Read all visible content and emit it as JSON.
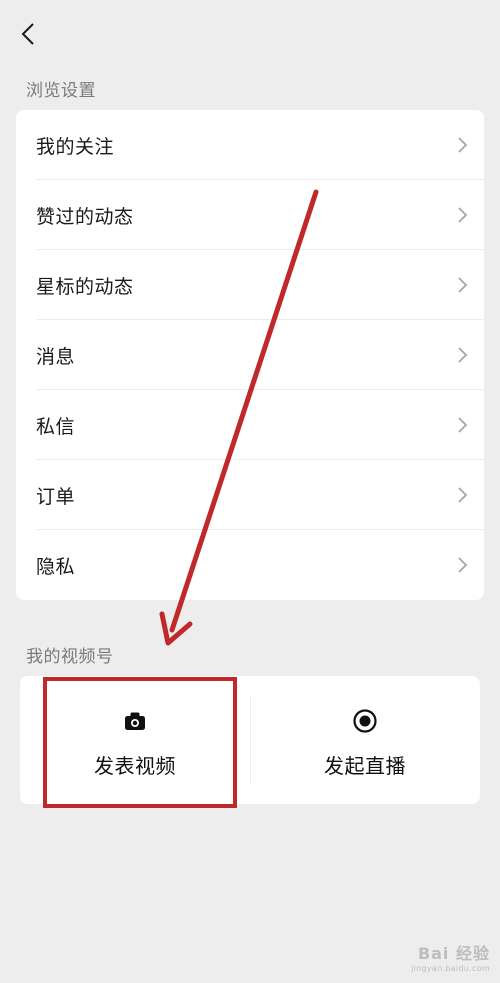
{
  "header": {
    "back_icon": "chevron-left-icon"
  },
  "browse_section": {
    "title": "浏览设置",
    "items": [
      {
        "label": "我的关注",
        "icon": "chevron-right-icon"
      },
      {
        "label": "赞过的动态",
        "icon": "chevron-right-icon"
      },
      {
        "label": "星标的动态",
        "icon": "chevron-right-icon"
      },
      {
        "label": "消息",
        "icon": "chevron-right-icon"
      },
      {
        "label": "私信",
        "icon": "chevron-right-icon"
      },
      {
        "label": "订单",
        "icon": "chevron-right-icon"
      },
      {
        "label": "隐私",
        "icon": "chevron-right-icon"
      }
    ]
  },
  "channel_section": {
    "title": "我的视频号",
    "actions": [
      {
        "label": "发表视频",
        "icon": "camera-icon"
      },
      {
        "label": "发起直播",
        "icon": "live-record-icon"
      }
    ]
  },
  "annotation": {
    "color": "#c0282a"
  },
  "watermark": {
    "main": "Bai 经验",
    "sub": "jingyan.baidu.com"
  }
}
